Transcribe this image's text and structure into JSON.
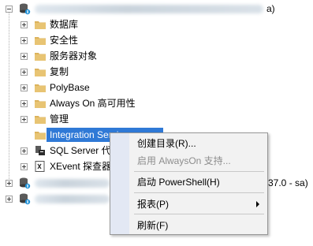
{
  "tree": {
    "server_suffix": "a)",
    "items": [
      {
        "label": "数据库"
      },
      {
        "label": "安全性"
      },
      {
        "label": "服务器对象"
      },
      {
        "label": "复制"
      },
      {
        "label": "PolyBase"
      },
      {
        "label": "Always On 高可用性"
      },
      {
        "label": "管理"
      },
      {
        "label": "Integration Services"
      },
      {
        "label": "SQL Server 代"
      },
      {
        "label": "XEvent 探查器"
      }
    ],
    "server2_suffix": "37.0 - sa)"
  },
  "context_menu": {
    "items": [
      {
        "label": "创建目录(R)...",
        "enabled": true
      },
      {
        "label": "启用 AlwaysOn 支持...",
        "enabled": false
      },
      {
        "label": "启动 PowerShell(H)",
        "enabled": true
      },
      {
        "label": "报表(P)",
        "enabled": true,
        "submenu": true
      },
      {
        "label": "刷新(F)",
        "enabled": true
      }
    ]
  },
  "colors": {
    "selection": "#2f79d6",
    "folder": "#dcb35c",
    "menu_bg": "#f2f2f2",
    "menu_gutter": "#e3e8f4",
    "disabled_text": "#8d8d8d"
  }
}
